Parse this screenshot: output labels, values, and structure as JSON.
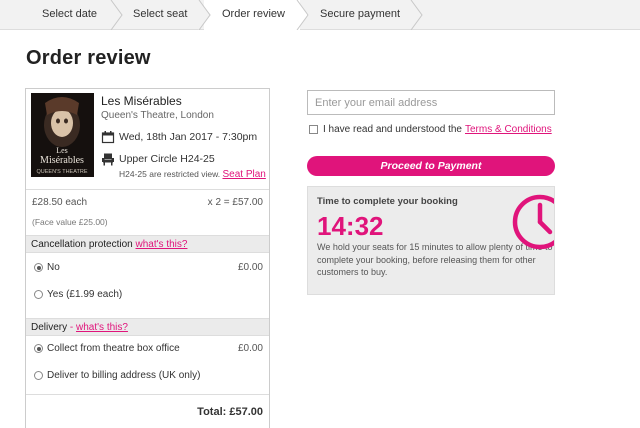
{
  "steps": [
    {
      "label": "Select date"
    },
    {
      "label": "Select seat"
    },
    {
      "label": "Order review"
    },
    {
      "label": "Secure payment"
    }
  ],
  "page_title": "Order review",
  "order": {
    "show_title": "Les Misérables",
    "venue": "Queen's Theatre, London",
    "poster": {
      "line1": "Les",
      "line2": "Misérables",
      "line3": "QUEEN'S THEATRE"
    },
    "datetime": "Wed, 18th Jan 2017 - 7:30pm",
    "seats": "Upper Circle H24-25",
    "restricted_note": "H24-25 are restricted view.",
    "seat_plan_link": "Seat Plan",
    "price_each": "£28.50 each",
    "price_calc": "x 2 = £57.00",
    "face_value": "(Face value £25.00)",
    "cancellation": {
      "heading": "Cancellation protection",
      "link": "what's this?",
      "options": [
        {
          "label": "No",
          "price": "£0.00",
          "selected": true
        },
        {
          "label": "Yes (£1.99 each)",
          "price": "",
          "selected": false
        }
      ]
    },
    "delivery": {
      "heading": "Delivery",
      "dash": " - ",
      "link": "what's this?",
      "options": [
        {
          "label": "Collect from theatre box office",
          "price": "£0.00",
          "selected": true
        },
        {
          "label": "Deliver to billing address (UK only)",
          "price": "",
          "selected": false
        }
      ]
    },
    "total": "Total: £57.00"
  },
  "checkout": {
    "email_placeholder": "Enter your email address",
    "terms_text": "I have read and understood the",
    "terms_link": "Terms & Conditions",
    "proceed_label": "Proceed to Payment"
  },
  "timer": {
    "title": "Time to complete your booking",
    "value": "14:32",
    "text": "We hold your seats for 15 minutes to allow plenty of time to complete your booking, before releasing them for other customers to buy."
  },
  "colors": {
    "accent": "#e0147b",
    "panel": "#ececec"
  }
}
